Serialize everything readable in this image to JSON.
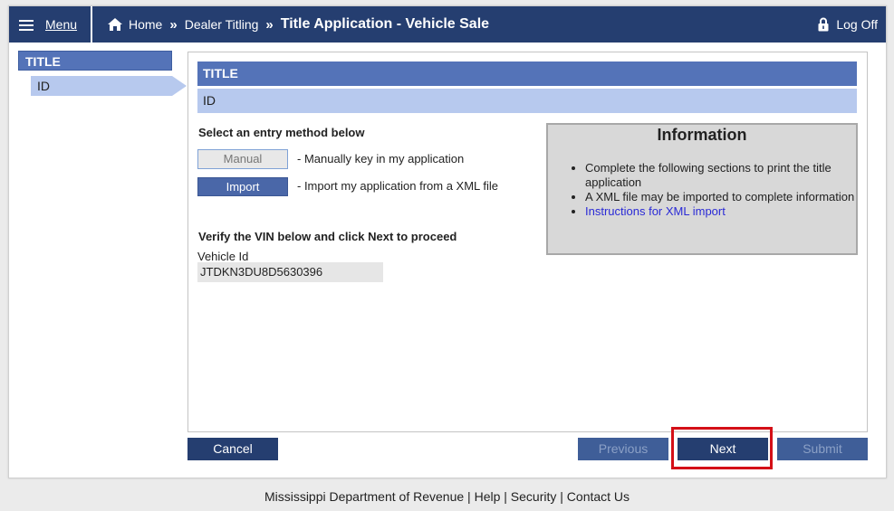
{
  "topbar": {
    "menu_label": "Menu",
    "home_label": "Home",
    "crumb_sep": "»",
    "dealer_label": "Dealer Titling",
    "page_title": "Title Application - Vehicle Sale",
    "logoff_label": "Log Off"
  },
  "sidebar": {
    "section": "TITLE",
    "items": [
      {
        "label": "ID"
      }
    ]
  },
  "main": {
    "section_title": "TITLE",
    "section_sub": "ID",
    "entry_heading": "Select an entry method below",
    "manual": {
      "label": "Manual",
      "desc": "- Manually key in my application"
    },
    "import": {
      "label": "Import",
      "desc": "- Import my application from a XML file"
    },
    "verify_heading": "Verify the VIN below and click Next to proceed",
    "vehicle_id_label": "Vehicle Id",
    "vehicle_id_value": "JTDKN3DU8D5630396"
  },
  "info": {
    "title": "Information",
    "items": [
      "Complete the following sections to print the title application",
      "A XML file may be imported to complete information"
    ],
    "link": "Instructions for XML import"
  },
  "actions": {
    "cancel": "Cancel",
    "previous": "Previous",
    "next": "Next",
    "submit": "Submit"
  },
  "footer": {
    "org": "Mississippi Department of Revenue",
    "sep": "|",
    "help": "Help",
    "security": "Security",
    "contact": "Contact Us"
  },
  "colors": {
    "navbar": "#253e70",
    "section_header": "#5473b8",
    "section_light": "#b7c9ee",
    "highlight": "#d40f17"
  }
}
